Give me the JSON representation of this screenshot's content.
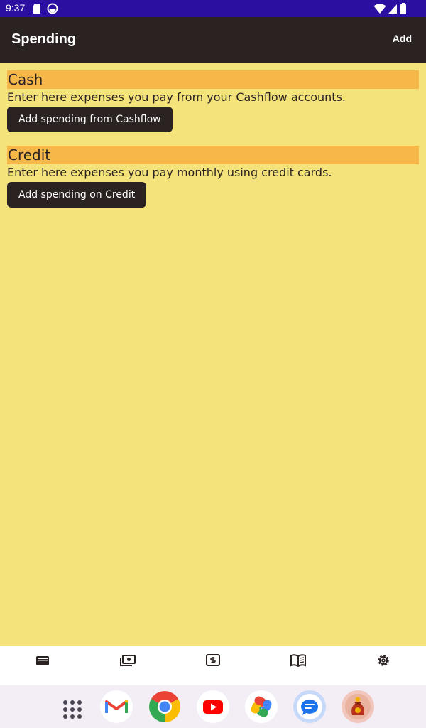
{
  "status_bar": {
    "time": "9:37",
    "icons": [
      "sd-card-icon",
      "sync-circle-icon",
      "wifi-icon",
      "signal-icon",
      "battery-icon"
    ]
  },
  "app_bar": {
    "title": "Spending",
    "action_label": "Add"
  },
  "sections": [
    {
      "title": "Cash",
      "description": "Enter here expenses you pay from your Cashflow accounts.",
      "button_label": "Add spending from Cashflow"
    },
    {
      "title": "Credit",
      "description": "Enter here expenses you pay monthly using credit cards.",
      "button_label": "Add spending on Credit"
    }
  ],
  "bottom_nav": {
    "items": [
      "wallet-icon",
      "cash-icon",
      "dollar-box-icon",
      "book-icon",
      "settings-icon"
    ]
  },
  "dock": {
    "apps": [
      "app-drawer-icon",
      "gmail-icon",
      "chrome-icon",
      "youtube-icon",
      "photos-icon",
      "messages-icon",
      "money-bag-app-icon"
    ]
  },
  "colors": {
    "status_bar": "#2a0fa0",
    "app_bar": "#2b2321",
    "background": "#f4e27b",
    "section_header": "#f5b849",
    "button": "#2b2321"
  }
}
